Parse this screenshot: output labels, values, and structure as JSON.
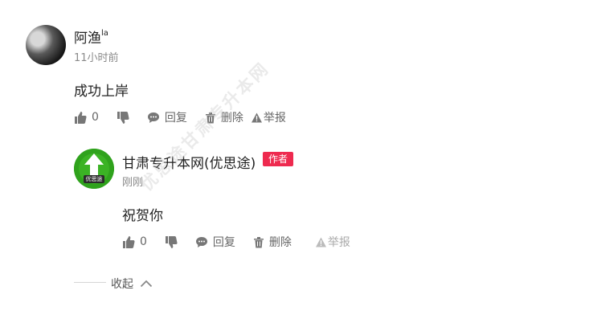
{
  "comment": {
    "author": "阿渔",
    "author_suffix": "la",
    "time": "11小时前",
    "text": "成功上岸",
    "like_count": "0",
    "reply_label": "回复",
    "delete_label": "删除",
    "report_label": "举报"
  },
  "reply": {
    "author": "甘肃专升本网(优思途)",
    "badge": "作者",
    "avatar_text": "优思途",
    "time": "刚刚",
    "text": "祝贺你",
    "like_count": "0",
    "reply_label": "回复",
    "delete_label": "删除",
    "report_label": "举报"
  },
  "collapse_label": "收起",
  "watermark": "优思途甘肃专升本网",
  "colors": {
    "badge": "#ee2a4f",
    "avatar_green": "#2fa21c",
    "icon": "#666666"
  }
}
